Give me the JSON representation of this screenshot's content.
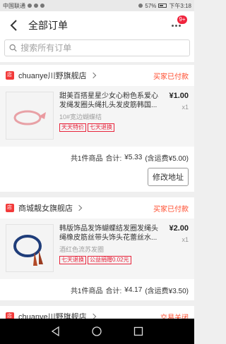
{
  "statusbar": {
    "carrier": "中国联通",
    "battery": "57%",
    "time": "下午3:18"
  },
  "header": {
    "title": "全部订单",
    "badge": "9+"
  },
  "search": {
    "placeholder": "搜索所有订单"
  },
  "orders": [
    {
      "shop": "chuanye川野旗舰店",
      "status": "买家已付款",
      "item": {
        "name": "甜美百搭星星少女心粉色系爱心发绳发圈头绳扎头发皮筋韩国...",
        "sku": "10#宽边蝴蝶结",
        "tags": [
          "天天特价",
          "七天退换"
        ],
        "price": "¥1.00",
        "qty": "x1"
      },
      "summary": {
        "count_text": "共1件商品",
        "total_label": "合计:",
        "total": "¥5.33",
        "shipping": "(含运费¥5.00)"
      },
      "action": "修改地址"
    },
    {
      "shop": "商城靓女旗舰店",
      "status": "买家已付款",
      "item": {
        "name": "韩版饰品发饰蝴蝶结发圈发绳头绳橡皮筋丝带头饰头花蕾丝水...",
        "sku": "酒红色流苏发圈",
        "tags": [
          "七天退换",
          "公益捐赠0.02元"
        ],
        "price": "¥2.00",
        "qty": "x1"
      },
      "summary": {
        "count_text": "共1件商品",
        "total_label": "合计:",
        "total": "¥4.17",
        "shipping": "(含运费¥3.50)"
      }
    },
    {
      "shop": "chuanye川野旗舰店",
      "status": "交易关闭"
    }
  ],
  "colors": {
    "accent": "#ff4a2b",
    "badge": "#f0243d",
    "tag": "#e8243b"
  }
}
